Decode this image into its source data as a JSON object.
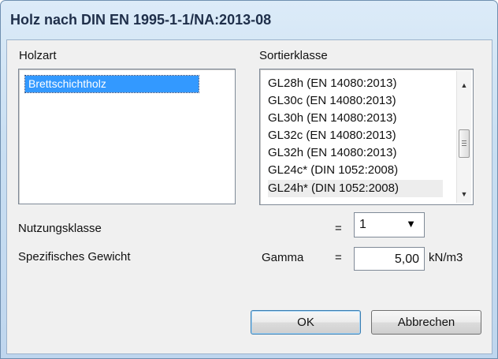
{
  "window": {
    "title": "Holz nach DIN EN 1995-1-1/NA:2013-08"
  },
  "holzart": {
    "label": "Holzart",
    "items": [
      "Brettschichtholz"
    ]
  },
  "sortierklasse": {
    "label": "Sortierklasse",
    "items": [
      "GL28h (EN 14080:2013)",
      "GL30c (EN 14080:2013)",
      "GL30h (EN 14080:2013)",
      "GL32c (EN 14080:2013)",
      "GL32h (EN 14080:2013)",
      "GL24c* (DIN 1052:2008)",
      "GL24h* (DIN 1052:2008)"
    ]
  },
  "nutzungsklasse": {
    "label": "Nutzungsklasse",
    "eq": "=",
    "value": "1"
  },
  "gewicht": {
    "label": "Spezifisches Gewicht",
    "symbol": "Gamma",
    "eq": "=",
    "value": "5,00",
    "unit": "kN/m3"
  },
  "buttons": {
    "ok": "OK",
    "cancel": "Abbrechen"
  }
}
